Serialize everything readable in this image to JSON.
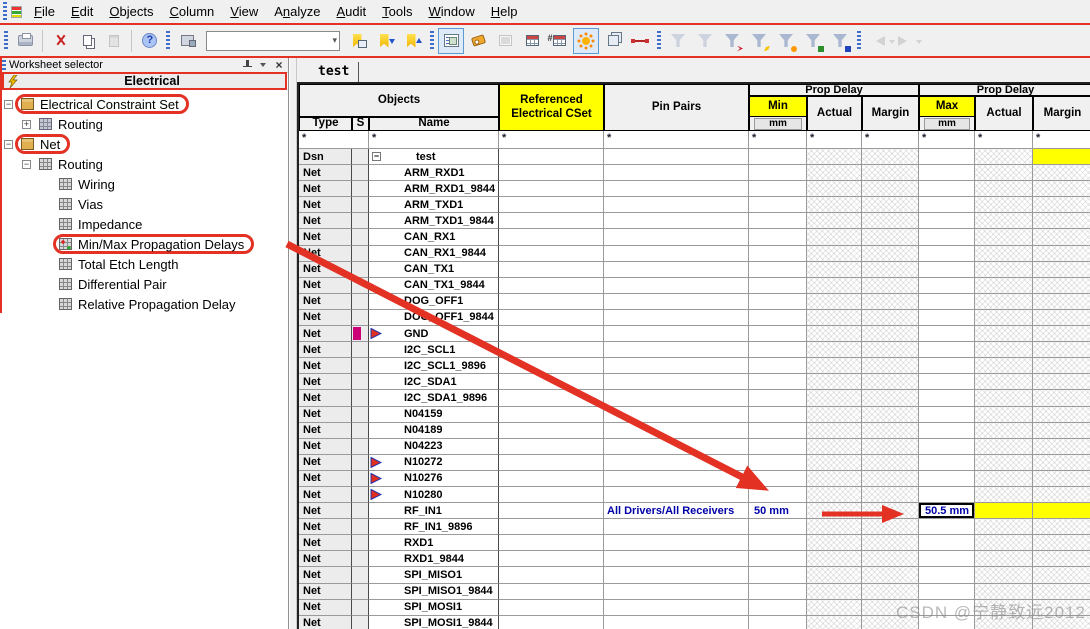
{
  "colors": {
    "annotation_red": "#e33124",
    "header_yellow": "#ffff00",
    "selection_blue": "#a8c5ef",
    "value_blue": "#0000a8",
    "s_marker_magenta": "#cc0077"
  },
  "menu": {
    "items": [
      {
        "pre": "",
        "u": "F",
        "post": "ile"
      },
      {
        "pre": "",
        "u": "E",
        "post": "dit"
      },
      {
        "pre": "",
        "u": "O",
        "post": "bjects"
      },
      {
        "pre": "",
        "u": "C",
        "post": "olumn"
      },
      {
        "pre": "",
        "u": "V",
        "post": "iew"
      },
      {
        "pre": "A",
        "u": "n",
        "post": "alyze"
      },
      {
        "pre": "",
        "u": "A",
        "post": "udit"
      },
      {
        "pre": "",
        "u": "T",
        "post": "ools"
      },
      {
        "pre": "",
        "u": "W",
        "post": "indow"
      },
      {
        "pre": "",
        "u": "H",
        "post": "elp"
      }
    ]
  },
  "toolbar": {
    "search_value": "",
    "buttons": [
      {
        "kind": "gripper"
      },
      {
        "kind": "btn",
        "name": "print-button",
        "icon": "printer"
      },
      {
        "kind": "sep"
      },
      {
        "kind": "btn",
        "name": "cut-button",
        "icon": "scissors"
      },
      {
        "kind": "btn",
        "name": "copy-button",
        "icon": "copy"
      },
      {
        "kind": "btn",
        "name": "paste-button",
        "icon": "paste",
        "disabled": true
      },
      {
        "kind": "sep"
      },
      {
        "kind": "btn",
        "name": "help-button",
        "icon": "help"
      },
      {
        "kind": "gripper"
      },
      {
        "kind": "btn",
        "name": "find-object-button",
        "icon": "find"
      },
      {
        "kind": "combo"
      },
      {
        "kind": "btn",
        "name": "bookmark-button",
        "icon": "bookmark"
      },
      {
        "kind": "btn",
        "name": "bookmark-down-button",
        "icon": "bookmark-down"
      },
      {
        "kind": "btn",
        "name": "bookmark-up-button",
        "icon": "bookmark-up"
      },
      {
        "kind": "gripper"
      },
      {
        "kind": "btn",
        "name": "worksheet-selector-button",
        "icon": "tree-view",
        "selected": true
      },
      {
        "kind": "btn",
        "name": "tag-button",
        "icon": "tag"
      },
      {
        "kind": "btn",
        "name": "hierarchy-button",
        "icon": "building",
        "disabled": true
      },
      {
        "kind": "btn",
        "name": "table-button",
        "icon": "grid"
      },
      {
        "kind": "btn",
        "name": "number-table-button",
        "icon": "number-grid"
      },
      {
        "kind": "btn",
        "name": "highlight-button",
        "icon": "sun",
        "selected": true
      },
      {
        "kind": "btn",
        "name": "copy-worksheet-button",
        "icon": "sheets"
      },
      {
        "kind": "btn",
        "name": "net-topology-button",
        "icon": "node"
      },
      {
        "kind": "gripper"
      },
      {
        "kind": "btn",
        "name": "filter-refresh-button",
        "icon": "funnel-refresh",
        "disabled": true
      },
      {
        "kind": "btn",
        "name": "filter-off-button",
        "icon": "funnel-off",
        "disabled": true
      },
      {
        "kind": "btn",
        "name": "filter-bowtie-button",
        "icon": "funnel-red",
        "badge": "red"
      },
      {
        "kind": "btn",
        "name": "filter-edit-button",
        "icon": "funnel-edit",
        "badge": "pencil"
      },
      {
        "kind": "btn",
        "name": "filter-highlight-button",
        "icon": "funnel-sun",
        "badge": "sun"
      },
      {
        "kind": "btn",
        "name": "filter-green-button",
        "icon": "funnel-green",
        "badge": "green"
      },
      {
        "kind": "btn",
        "name": "filter-blue-button",
        "icon": "funnel-blue",
        "badge": "blue"
      },
      {
        "kind": "gripper"
      },
      {
        "kind": "btn",
        "name": "back-button",
        "icon": "arrow-left",
        "disabled": true,
        "badge": "caret"
      },
      {
        "kind": "btn",
        "name": "forward-button",
        "icon": "arrow-right",
        "disabled": true,
        "badge": "caret"
      }
    ]
  },
  "left_panel": {
    "title": "Worksheet selector",
    "header": "Electrical",
    "tree": [
      {
        "label": "Electrical Constraint Set",
        "level": 0,
        "exp": "−",
        "icon": "stack",
        "bold": true,
        "annotated": true
      },
      {
        "label": "Routing",
        "level": 1,
        "exp": "+",
        "icon": "cube"
      },
      {
        "label": "Net",
        "level": 0,
        "exp": "−",
        "icon": "stack",
        "bold": true,
        "annotated": true
      },
      {
        "label": "Routing",
        "level": 1,
        "exp": "−",
        "icon": "grid"
      },
      {
        "label": "Wiring",
        "level": 2,
        "icon": "grid"
      },
      {
        "label": "Vias",
        "level": 2,
        "icon": "grid"
      },
      {
        "label": "Impedance",
        "level": 2,
        "icon": "grid"
      },
      {
        "label": "Min/Max Propagation Delays",
        "level": 2,
        "icon": "grid-colored",
        "annotated": true
      },
      {
        "label": "Total Etch Length",
        "level": 2,
        "icon": "grid"
      },
      {
        "label": "Differential Pair",
        "level": 2,
        "icon": "grid"
      },
      {
        "label": "Relative Propagation Delay",
        "level": 2,
        "icon": "grid"
      }
    ]
  },
  "tabs": {
    "active": "test"
  },
  "table": {
    "header": {
      "objects": "Objects",
      "type": "Type",
      "s": "S",
      "name": "Name",
      "ref1": "Referenced",
      "ref2": "Electrical CSet",
      "pin_pairs": "Pin Pairs",
      "prop_delay": "Prop Delay",
      "min": "Min",
      "max": "Max",
      "actual": "Actual",
      "margin": "Margin",
      "unit": "mm",
      "filter": "*"
    },
    "rows": [
      {
        "type": "Dsn",
        "name": "test",
        "dsn": true,
        "exp": "−",
        "dsn_yellow": true
      },
      {
        "type": "Net",
        "name": "ARM_RXD1"
      },
      {
        "type": "Net",
        "name": "ARM_RXD1_9844"
      },
      {
        "type": "Net",
        "name": "ARM_TXD1"
      },
      {
        "type": "Net",
        "name": "ARM_TXD1_9844"
      },
      {
        "type": "Net",
        "name": "CAN_RX1"
      },
      {
        "type": "Net",
        "name": "CAN_RX1_9844"
      },
      {
        "type": "Net",
        "name": "CAN_TX1"
      },
      {
        "type": "Net",
        "name": "CAN_TX1_9844"
      },
      {
        "type": "Net",
        "name": "DOG_OFF1"
      },
      {
        "type": "Net",
        "name": "DOG_OFF1_9844"
      },
      {
        "type": "Net",
        "name": "GND",
        "flag": true,
        "sflag": true
      },
      {
        "type": "Net",
        "name": "I2C_SCL1"
      },
      {
        "type": "Net",
        "name": "I2C_SCL1_9896"
      },
      {
        "type": "Net",
        "name": "I2C_SDA1"
      },
      {
        "type": "Net",
        "name": "I2C_SDA1_9896"
      },
      {
        "type": "Net",
        "name": "N04159"
      },
      {
        "type": "Net",
        "name": "N04189"
      },
      {
        "type": "Net",
        "name": "N04223"
      },
      {
        "type": "Net",
        "name": "N10272",
        "flag": true
      },
      {
        "type": "Net",
        "name": "N10276",
        "flag": true
      },
      {
        "type": "Net",
        "name": "N10280",
        "flag": true
      },
      {
        "type": "Net",
        "name": "RF_IN1",
        "selected": true,
        "pin_pairs": "All Drivers/All Receivers",
        "min": "50 mm",
        "max": "50.5 mm",
        "yellow": true
      },
      {
        "type": "Net",
        "name": "RF_IN1_9896"
      },
      {
        "type": "Net",
        "name": "RXD1"
      },
      {
        "type": "Net",
        "name": "RXD1_9844"
      },
      {
        "type": "Net",
        "name": "SPI_MISO1"
      },
      {
        "type": "Net",
        "name": "SPI_MISO1_9844"
      },
      {
        "type": "Net",
        "name": "SPI_MOSI1"
      },
      {
        "type": "Net",
        "name": "SPI_MOSI1_9844"
      }
    ]
  },
  "watermark": "CSDN @宁静致远2012"
}
